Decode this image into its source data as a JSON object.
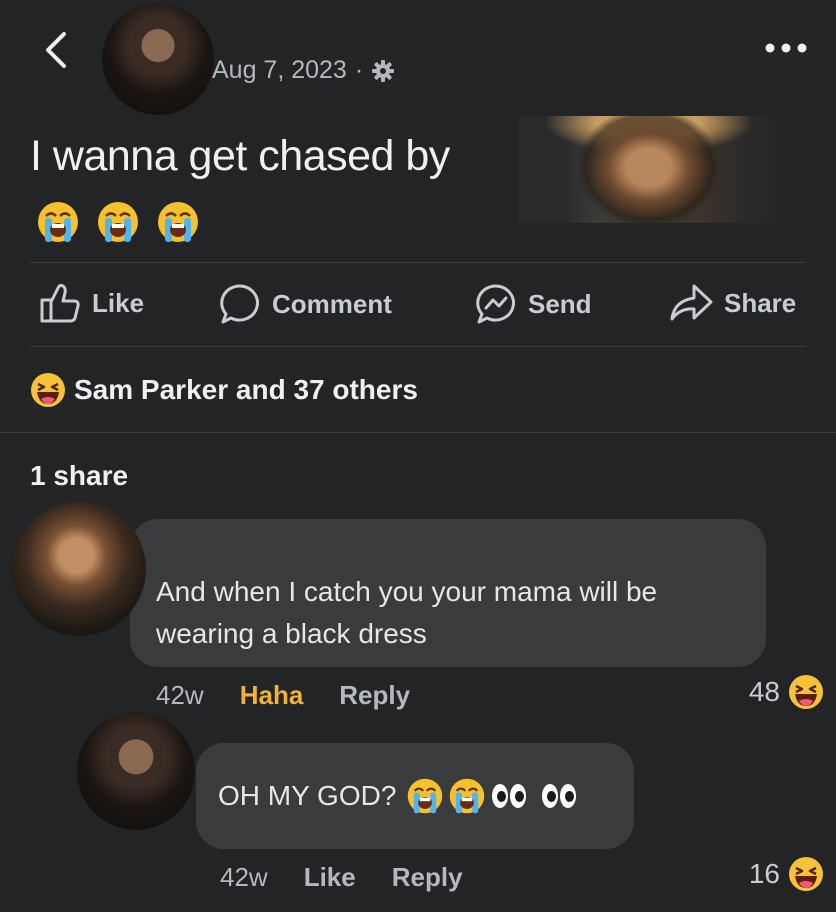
{
  "header": {
    "date": "Aug 7, 2023",
    "separator": "·",
    "privacy_icon": "gear-icon",
    "back_icon": "chevron-left-icon",
    "more_icon": "ellipsis-icon"
  },
  "post": {
    "text": "I wanna get chased by",
    "emoji": [
      "loudly-crying-face",
      "loudly-crying-face",
      "loudly-crying-face"
    ]
  },
  "actions": [
    {
      "label": "Like",
      "icon": "thumbs-up-icon"
    },
    {
      "label": "Comment",
      "icon": "comment-bubble-icon"
    },
    {
      "label": "Send",
      "icon": "messenger-icon"
    },
    {
      "label": "Share",
      "icon": "share-arrow-icon"
    }
  ],
  "reactions": {
    "icon": "haha-icon",
    "text": "Sam Parker and 37 others"
  },
  "shares": "1 share",
  "comments": [
    {
      "text": "And when I catch you your mama will be wearing a black dress",
      "time": "42w",
      "reaction_label": "Haha",
      "reply_label": "Reply",
      "reaction_count": "48"
    },
    {
      "text": "OH MY GOD?",
      "time": "42w",
      "like_label": "Like",
      "reply_label": "Reply",
      "reaction_count": "16"
    }
  ],
  "colors": {
    "background": "#232425",
    "bubble": "#3a3b3c",
    "haha_active": "#f0b23c",
    "secondary_text": "#b5b8bd"
  }
}
